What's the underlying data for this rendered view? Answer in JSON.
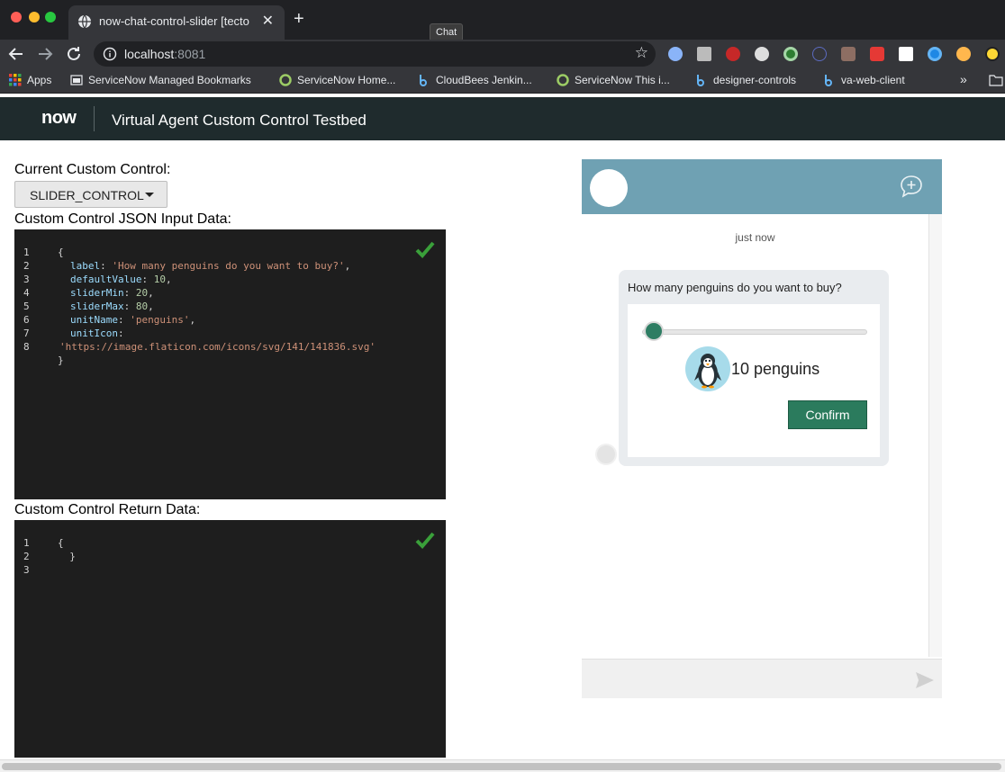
{
  "browser": {
    "tab_title": "now-chat-control-slider [tecto",
    "tab_close": "✕",
    "new_tab": "+",
    "tooltip": "Chat",
    "url_host": "localhost",
    "url_port": ":8081",
    "star": "☆",
    "bookmarks_overflow": "»",
    "bookmarks": [
      {
        "label": "Apps",
        "icon": "apps-grid-icon"
      },
      {
        "label": "ServiceNow Managed Bookmarks",
        "icon": "folder-icon"
      },
      {
        "label": "ServiceNow Home...",
        "icon": "servicenow-icon"
      },
      {
        "label": "CloudBees Jenkin...",
        "icon": "cloudbees-icon"
      },
      {
        "label": "ServiceNow This i...",
        "icon": "servicenow-icon"
      },
      {
        "label": "designer-controls",
        "icon": "cloudbees-icon"
      },
      {
        "label": "va-web-client",
        "icon": "cloudbees-icon"
      }
    ]
  },
  "app": {
    "logo": "now",
    "title": "Virtual Agent Custom Control Testbed"
  },
  "left": {
    "current_label": "Current Custom Control:",
    "current_value": "SLIDER_CONTROL",
    "json_label": "Custom Control JSON Input Data:",
    "return_label": "Custom Control Return Data:"
  },
  "json_editor": {
    "lines": [
      {
        "n": "1",
        "code": "{"
      },
      {
        "n": "2",
        "key": "label",
        "str": "'How many penguins do you want to buy?'"
      },
      {
        "n": "3",
        "key": "defaultValue",
        "num": "10"
      },
      {
        "n": "4",
        "key": "sliderMin",
        "num": "20"
      },
      {
        "n": "5",
        "key": "sliderMax",
        "num": "80"
      },
      {
        "n": "6",
        "key": "unitName",
        "str": "'penguins'"
      },
      {
        "n": "7",
        "key": "unitIcon"
      },
      {
        "n": "8",
        "str": "'https://image.flaticon.com/icons/svg/141/141836.svg'"
      },
      {
        "n": "",
        "code": "}"
      }
    ]
  },
  "return_editor": {
    "lines": [
      {
        "n": "1",
        "code": "{"
      },
      {
        "n": "2",
        "code": "  }"
      },
      {
        "n": "3",
        "code": ""
      }
    ]
  },
  "chat": {
    "timestamp": "just now",
    "question": "How many penguins do you want to buy?",
    "slider_fraction": 0.0,
    "value_text": "10 penguins",
    "confirm_label": "Confirm",
    "header_color": "#6fa1b3",
    "accent_color": "#2b7b5d"
  }
}
